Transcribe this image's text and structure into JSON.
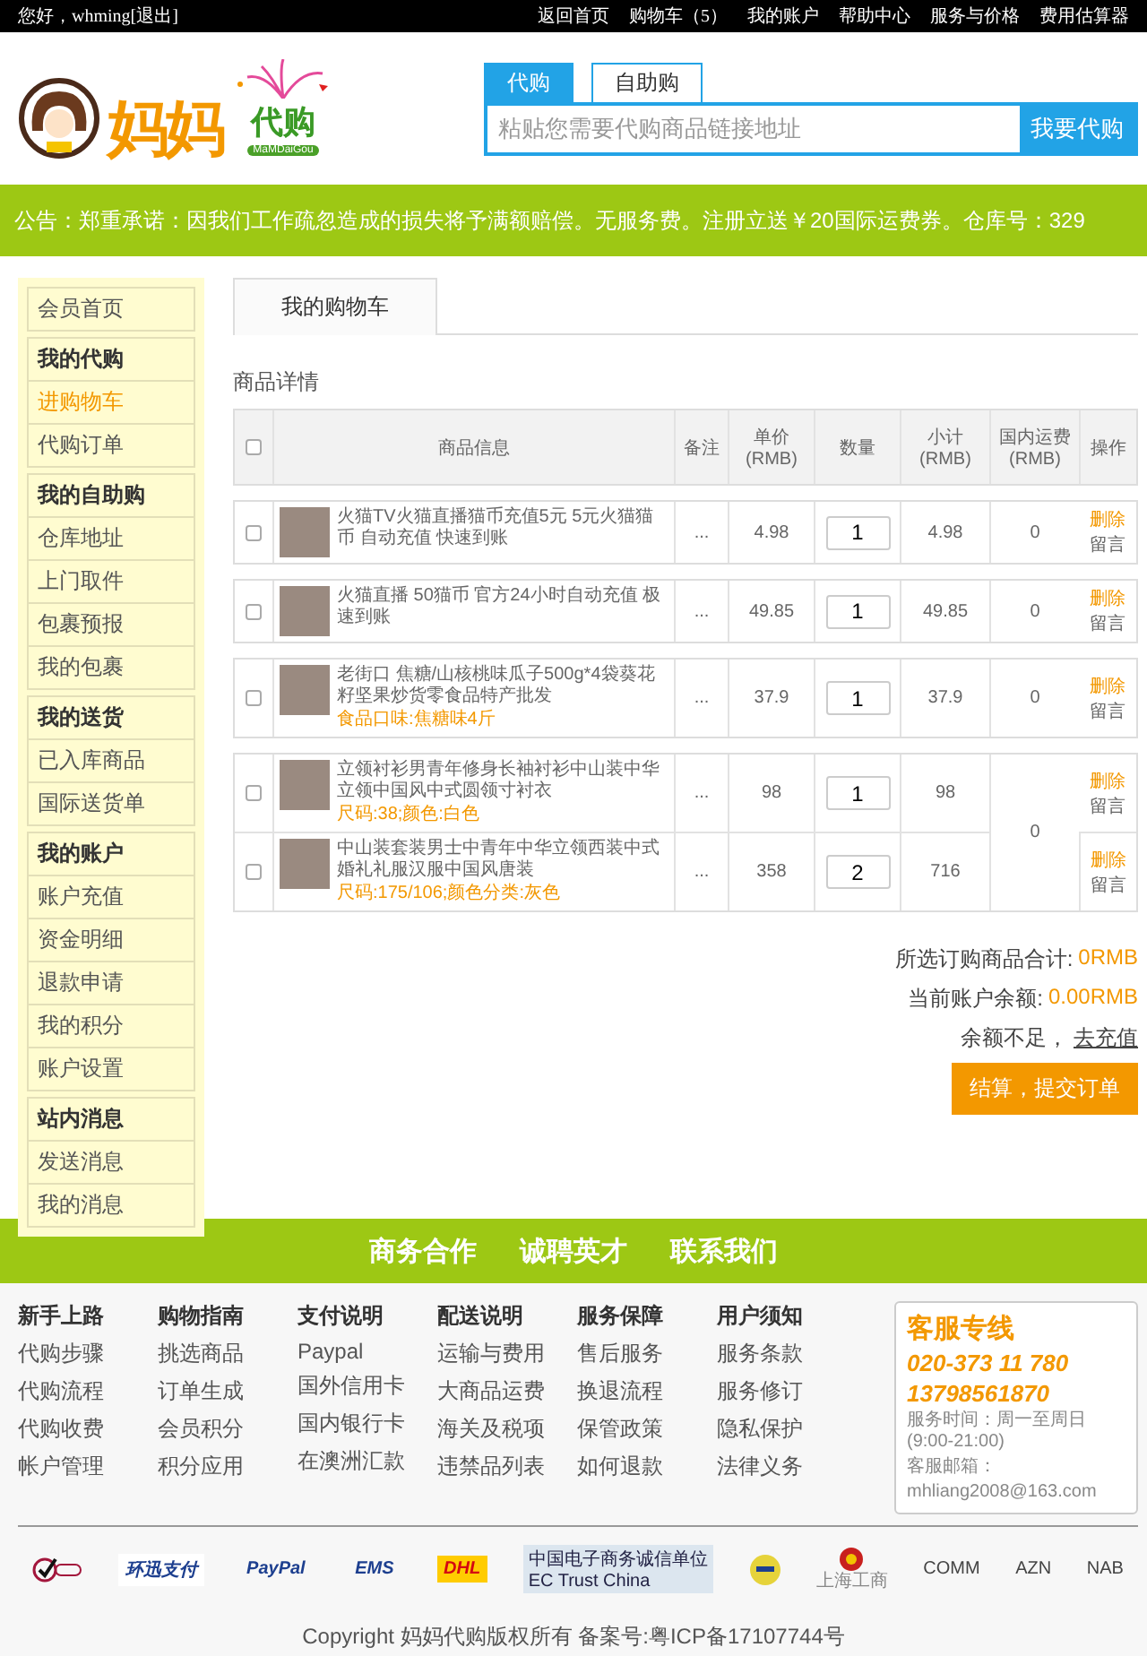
{
  "top_bar": {
    "greeting": "您好，whming",
    "logout": "[退出]",
    "links": [
      "返回首页",
      "购物车（5）",
      "我的账户",
      "帮助中心",
      "服务与价格",
      "费用估算器"
    ]
  },
  "header": {
    "logo": {
      "name": "妈妈",
      "suffix": "代购",
      "latin": "MaMDaiGou"
    },
    "search": {
      "tabs": [
        {
          "label": "代购",
          "selected": true
        },
        {
          "label": "自助购",
          "selected": false
        }
      ],
      "placeholder": "粘贴您需要代购商品链接地址",
      "button": "我要代购"
    }
  },
  "notice": "公告：郑重承诺：因我们工作疏忽造成的损失将予满额赔偿。无服务费。注册立送￥20国际运费券。仓库号：329",
  "sidebar": [
    {
      "items": [
        {
          "label": "会员首页",
          "selected": false
        }
      ]
    },
    {
      "title": "我的代购",
      "items": [
        {
          "label": "进购物车",
          "selected": true
        },
        {
          "label": "代购订单",
          "selected": false
        }
      ]
    },
    {
      "title": "我的自助购",
      "items": [
        {
          "label": "仓库地址",
          "selected": false
        },
        {
          "label": "上门取件",
          "selected": false
        },
        {
          "label": "包裹预报",
          "selected": false
        },
        {
          "label": "我的包裹",
          "selected": false
        }
      ]
    },
    {
      "title": "我的送货",
      "items": [
        {
          "label": "已入库商品",
          "selected": false
        },
        {
          "label": "国际送货单",
          "selected": false
        }
      ]
    },
    {
      "title": "我的账户",
      "items": [
        {
          "label": "账户充值",
          "selected": false
        },
        {
          "label": "资金明细",
          "selected": false
        },
        {
          "label": "退款申请",
          "selected": false
        },
        {
          "label": "我的积分",
          "selected": false
        },
        {
          "label": "账户设置",
          "selected": false
        }
      ]
    },
    {
      "title": "站内消息",
      "items": [
        {
          "label": "发送消息",
          "selected": false
        },
        {
          "label": "我的消息",
          "selected": false
        }
      ]
    }
  ],
  "cart": {
    "tab": "我的购物车",
    "section_title": "商品详情",
    "columns": [
      "商品信息",
      "备注",
      "单价(RMB)",
      "数量",
      "小计(RMB)",
      "国内运费(RMB)",
      "操作"
    ],
    "all_checked": false,
    "groups": [
      {
        "freight": "0",
        "items": [
          {
            "checked": false,
            "name": "火猫TV火猫直播猫币充值5元 5元火猫猫币 自动充值 快速到账",
            "remark": "...",
            "price": "4.98",
            "quantity": "1",
            "subtotal": "4.98",
            "actions": [
              "删除",
              "留言"
            ]
          }
        ]
      },
      {
        "freight": "0",
        "items": [
          {
            "checked": false,
            "name": "火猫直播 50猫币 官方24小时自动充值 极速到账",
            "remark": "...",
            "price": "49.85",
            "quantity": "1",
            "subtotal": "49.85",
            "actions": [
              "删除",
              "留言"
            ]
          }
        ]
      },
      {
        "freight": "0",
        "items": [
          {
            "checked": false,
            "name": "老街口 焦糖/山核桃味瓜子500g*4袋葵花籽坚果炒货零食品特产批发",
            "spec": "食品口味:焦糖味4斤",
            "remark": "...",
            "price": "37.9",
            "quantity": "1",
            "subtotal": "37.9",
            "actions": [
              "删除",
              "留言"
            ]
          }
        ]
      },
      {
        "freight": "0",
        "items": [
          {
            "checked": false,
            "name": "立领衬衫男青年修身长袖衬衫中山装中华立领中国风中式圆领寸衬衣",
            "spec": "尺码:38;颜色:白色",
            "remark": "...",
            "price": "98",
            "quantity": "1",
            "subtotal": "98",
            "actions": [
              "删除",
              "留言"
            ]
          },
          {
            "checked": false,
            "name": "中山装套装男士中青年中华立领西装中式婚礼礼服汉服中国风唐装",
            "spec": "尺码:175/106;颜色分类:灰色",
            "remark": "...",
            "price": "358",
            "quantity": "2",
            "subtotal": "716",
            "actions": [
              "删除",
              "留言"
            ]
          }
        ]
      }
    ],
    "summary": [
      {
        "label": "所选订购商品合计:",
        "value": "0RMB"
      },
      {
        "label": "当前账户余额:",
        "value": "0.00RMB"
      }
    ],
    "shortfall": "余额不足，",
    "recharge": "去充值",
    "submit": "结算，提交订单"
  },
  "footer": {
    "nav": [
      "商务合作",
      "诚聘英才",
      "联系我们"
    ],
    "columns": [
      {
        "title": "新手上路",
        "links": [
          "代购步骤",
          "代购流程",
          "代购收费",
          "帐户管理"
        ]
      },
      {
        "title": "购物指南",
        "links": [
          "挑选商品",
          "订单生成",
          "会员积分",
          "积分应用"
        ]
      },
      {
        "title": "支付说明",
        "links": [
          "Paypal",
          "国外信用卡",
          "国内银行卡",
          "在澳洲汇款"
        ]
      },
      {
        "title": "配送说明",
        "links": [
          "运输与费用",
          "大商品运费",
          "海关及税项",
          "违禁品列表"
        ]
      },
      {
        "title": "服务保障",
        "links": [
          "售后服务",
          "换退流程",
          "保管政策",
          "如何退款"
        ]
      },
      {
        "title": "用户须知",
        "links": [
          "服务条款",
          "服务修订",
          "隐私保护",
          "法律义务"
        ]
      }
    ],
    "contact": {
      "title": "客服专线",
      "phones": [
        "020-373 11 780",
        "13798561870"
      ],
      "hours": "服务时间：周一至周日(9:00-21:00)",
      "email_label": "客服邮箱：",
      "email": "mhliang2008@163.com"
    },
    "badges": [
      {
        "kind": "seal"
      },
      {
        "kind": "ips",
        "label": "环迅支付"
      },
      {
        "kind": "paypal",
        "label": "PayPal"
      },
      {
        "kind": "ems",
        "label": "EMS"
      },
      {
        "kind": "dhl",
        "label": "DHL"
      },
      {
        "kind": "trust",
        "label": "中国电子商务诚信单位",
        "sub": "EC Trust China"
      },
      {
        "kind": "coin"
      },
      {
        "kind": "emblem",
        "label": "上海工商"
      },
      {
        "kind": "plain",
        "label": "COMM"
      },
      {
        "kind": "plain",
        "label": "AZN"
      },
      {
        "kind": "plain",
        "label": "NAB"
      }
    ],
    "copyright": "Copyright 妈妈代购版权所有 备案号:粤ICP备17107744号"
  }
}
